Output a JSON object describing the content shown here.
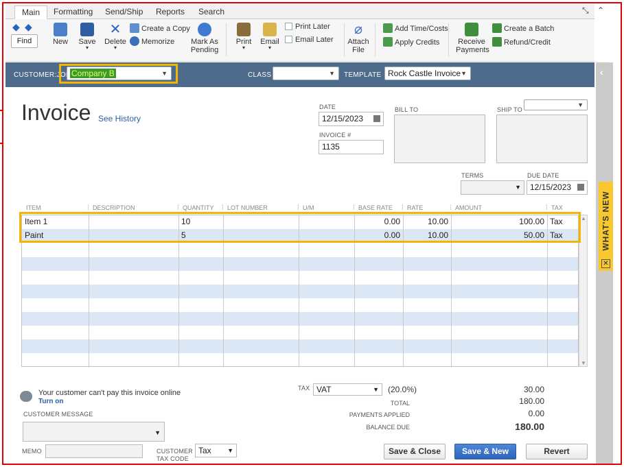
{
  "tabs": [
    "Main",
    "Formatting",
    "Send/Ship",
    "Reports",
    "Search"
  ],
  "toolbar": {
    "find": "Find",
    "new": "New",
    "save": "Save",
    "delete": "Delete",
    "create_copy": "Create a Copy",
    "memorize": "Memorize",
    "mark_as": "Mark As",
    "pending": "Pending",
    "print": "Print",
    "email": "Email",
    "print_later": "Print Later",
    "email_later": "Email Later",
    "attach": "Attach",
    "file": "File",
    "add_time_costs": "Add Time/Costs",
    "apply_credits": "Apply Credits",
    "receive": "Receive",
    "payments": "Payments",
    "create_batch": "Create a Batch",
    "refund_credit": "Refund/Credit"
  },
  "header": {
    "customer_job_label": "CUSTOMER:JOB",
    "customer_job_value": "Company B",
    "class_label": "CLASS",
    "class_value": "",
    "template_label": "TEMPLATE",
    "template_value": "Rock Castle Invoice"
  },
  "form": {
    "title": "Invoice",
    "see_history": "See History",
    "date_label": "DATE",
    "date_value": "12/15/2023",
    "invoice_no_label": "INVOICE #",
    "invoice_no_value": "1135",
    "bill_to_label": "BILL TO",
    "ship_to_label": "SHIP TO",
    "terms_label": "TERMS",
    "due_date_label": "DUE DATE",
    "due_date_value": "12/15/2023"
  },
  "grid": {
    "columns": [
      "ITEM",
      "DESCRIPTION",
      "QUANTITY",
      "LOT NUMBER",
      "U/M",
      "BASE RATE",
      "RATE",
      "AMOUNT",
      "TAX"
    ],
    "rows": [
      {
        "item": "Item 1",
        "description": "",
        "quantity": "10",
        "lot": "",
        "um": "",
        "base_rate": "0.00",
        "rate": "10.00",
        "amount": "100.00",
        "tax": "Tax"
      },
      {
        "item": "Paint",
        "description": "",
        "quantity": "5",
        "lot": "",
        "um": "",
        "base_rate": "0.00",
        "rate": "10.00",
        "amount": "50.00",
        "tax": "Tax"
      }
    ]
  },
  "footer": {
    "online_msg": "Your customer can't pay this invoice online",
    "turn_on": "Turn on",
    "customer_message_label": "CUSTOMER MESSAGE",
    "memo_label": "MEMO",
    "customer_tax_code_label_1": "CUSTOMER",
    "customer_tax_code_label_2": "TAX CODE",
    "customer_tax_code_value": "Tax",
    "tax_label": "TAX",
    "tax_value": "VAT",
    "tax_rate": "(20.0%)",
    "tax_amount": "30.00",
    "total_label": "TOTAL",
    "total_value": "180.00",
    "payments_applied_label": "PAYMENTS APPLIED",
    "payments_applied_value": "0.00",
    "balance_due_label": "BALANCE DUE",
    "balance_due_value": "180.00",
    "save_close": "Save & Close",
    "save_new": "Save & New",
    "revert": "Revert"
  },
  "side_panel": {
    "whats_new": "WHAT'S NEW"
  }
}
